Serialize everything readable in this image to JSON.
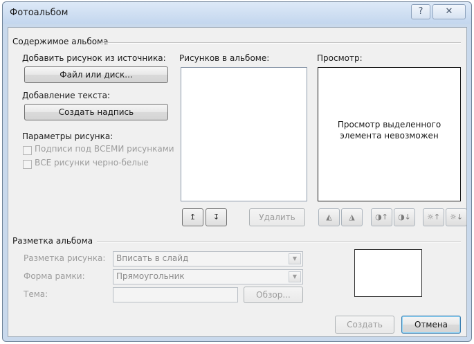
{
  "window": {
    "title": "Фотоальбом",
    "help_glyph": "?",
    "close_glyph": "✕"
  },
  "content_group": {
    "title": "Содержимое альбома",
    "add_picture_label": "Добавить рисунок из источника:",
    "file_button": "Файл или диск...",
    "add_text_label": "Добавление текста:",
    "new_textbox_button": "Создать надпись",
    "picture_options_label": "Параметры рисунка:",
    "captions_checkbox": "Подписи под ВСЕМИ рисунками",
    "bw_checkbox": "ВСЕ рисунки черно-белые",
    "pictures_in_album_label": "Рисунков в альбоме:",
    "move_up_glyph": "↥",
    "move_down_glyph": "↧",
    "remove_button": "Удалить",
    "preview_label": "Просмотр:",
    "preview_message": "Просмотр выделенного элемента невозможен",
    "tool_icons": {
      "rotate_left": "◭",
      "rotate_right": "◮",
      "contrast_up": "◑↑",
      "contrast_down": "◑↓",
      "brightness_up": "☼↑",
      "brightness_down": "☼↓"
    }
  },
  "layout_group": {
    "title": "Разметка альбома",
    "picture_layout_label": "Разметка рисунка:",
    "picture_layout_value": "Вписать в слайд",
    "frame_shape_label": "Форма рамки:",
    "frame_shape_value": "Прямоугольник",
    "theme_label": "Тема:",
    "theme_value": "",
    "browse_button": "Обзор...",
    "dropdown_glyph": "▼"
  },
  "footer": {
    "create_button": "Создать",
    "cancel_button": "Отмена"
  }
}
